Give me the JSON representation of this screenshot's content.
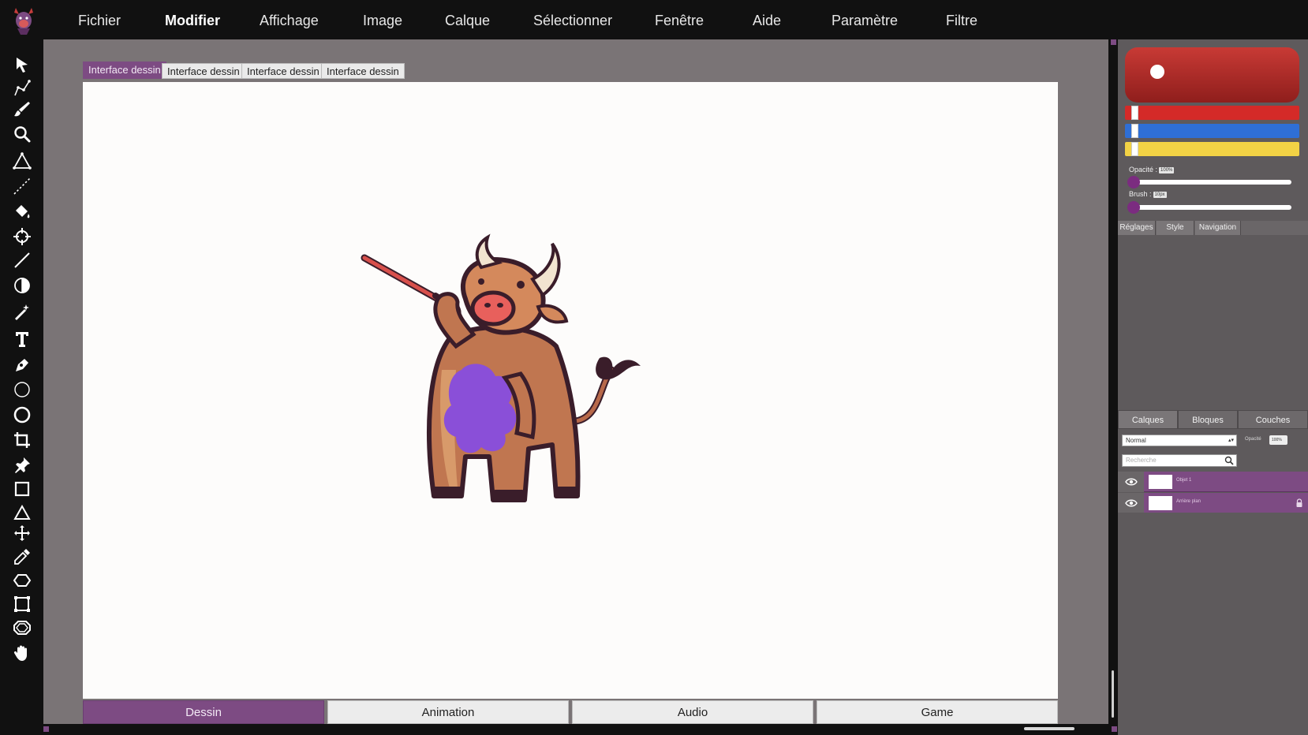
{
  "menu": {
    "items": [
      "Fichier",
      "Modifier",
      "Affichage",
      "Image",
      "Calque",
      "Sélectionner",
      "Fenêtre",
      "Aide",
      "Paramètre",
      "Filtre"
    ],
    "active_index": 1
  },
  "tools": [
    "select-arrow-icon",
    "path-select-icon",
    "brush-icon",
    "zoom-icon",
    "polygon-icon",
    "dashed-line-icon",
    "paint-bucket-icon",
    "crosshair-icon",
    "line-icon",
    "contrast-icon",
    "magic-wand-icon",
    "text-icon",
    "pen-icon",
    "ellipse-outline-icon",
    "circle-icon",
    "crop-icon",
    "pin-icon",
    "rectangle-icon",
    "triangle-icon",
    "move-icon",
    "eyedropper-icon",
    "hexagon-icon",
    "frame-icon",
    "octagon-icon",
    "hand-icon"
  ],
  "document_tabs": [
    "Interface dessin",
    "Interface dessin",
    "Interface dessin",
    "Interface dessin"
  ],
  "active_document_tab": 0,
  "bottom_tabs": [
    "Dessin",
    "Animation",
    "Audio",
    "Game"
  ],
  "active_bottom_tab": 0,
  "colors": {
    "accent": "#7d4b83",
    "preview": "#b82e2b",
    "bar_red": "#d42a28",
    "bar_blue": "#2f6fd6",
    "bar_yellow": "#f2d245",
    "slider_knob": "#7b2c80"
  },
  "brush_panel": {
    "opacity_label": "Opacité :",
    "opacity_value": "100%",
    "opacity_level": 0,
    "brush_label": "Brush :",
    "brush_value": "10px",
    "brush_level": 0
  },
  "panel_tabs": [
    "Réglages",
    "Style",
    "Navigation"
  ],
  "layer_tabs": [
    "Calques",
    "Bloques",
    "Couches"
  ],
  "layers_panel": {
    "blend_mode": "Normal",
    "opacity_label": "Opacité",
    "opacity_value": "100%",
    "search_placeholder": "Recherche",
    "layers": [
      {
        "name": "Objet 1",
        "visible": true,
        "locked": false
      },
      {
        "name": "Arrière plan",
        "visible": true,
        "locked": true
      }
    ]
  }
}
